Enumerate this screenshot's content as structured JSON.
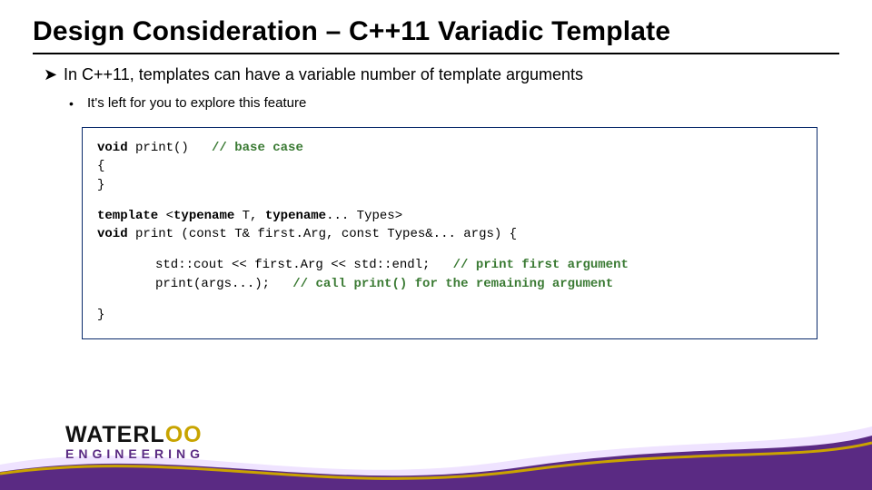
{
  "title": "Design Consideration – C++11 Variadic Template",
  "bullets": {
    "l1_marker": "➤",
    "l1_text": "In C++11, templates can have a variable number of template arguments",
    "l2_marker": "•",
    "l2_text": "It's left for you to explore this feature"
  },
  "code": {
    "r1_kw": "void",
    "r1_rest": " print()   ",
    "r1_cm": "// base case",
    "r2": "{",
    "r3": "}",
    "r4_kw1": "template",
    "r4_mid1": " <",
    "r4_kw2": "typename",
    "r4_mid2": " T, ",
    "r4_kw3": "typename",
    "r4_rest": "... Types>",
    "r5_kw": "void",
    "r5_rest": " print (const T& first.Arg, const Types&... args) {",
    "r6_a": "std::cout << first.Arg << std::endl;   ",
    "r6_cm": "// print first argument",
    "r7_a": "print(args...);   ",
    "r7_cm": "// call print() for the remaining argument",
    "r8": "}"
  },
  "logo": {
    "brand_pre": "WATERL",
    "brand_oo": "OO",
    "sub": "ENGINEERING"
  }
}
